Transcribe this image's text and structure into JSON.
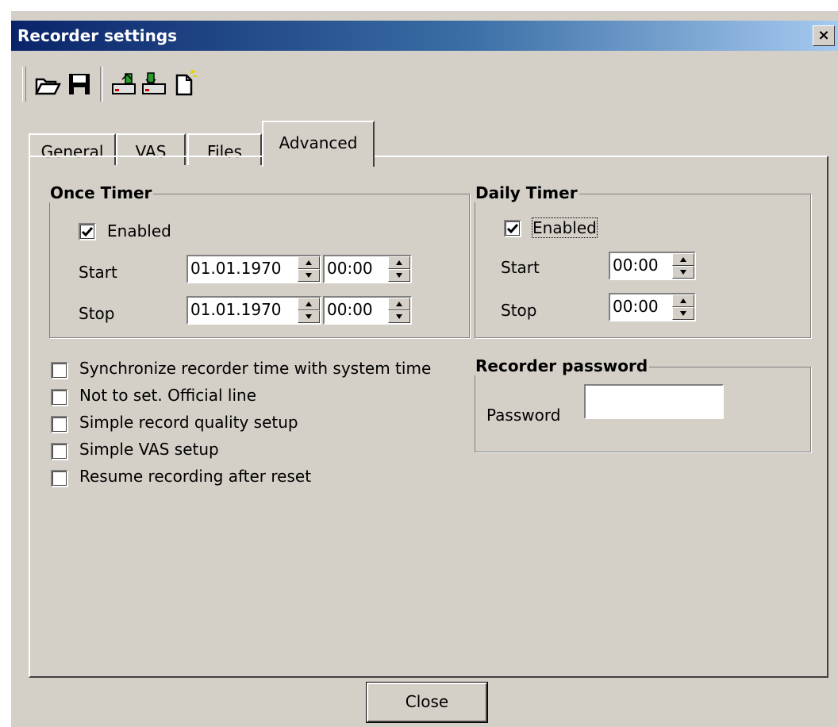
{
  "window": {
    "title": "Recorder settings",
    "close_glyph": "×"
  },
  "toolbar": {
    "buttons": [
      {
        "icon": "open-folder-icon"
      },
      {
        "icon": "save-disk-icon"
      },
      {
        "icon": "read-from-recorder-icon"
      },
      {
        "icon": "write-to-recorder-icon"
      },
      {
        "icon": "new-document-icon"
      }
    ]
  },
  "tabs": [
    {
      "label": "General",
      "active": false
    },
    {
      "label": "VAS",
      "active": false
    },
    {
      "label": "Files",
      "active": false
    },
    {
      "label": "Advanced",
      "active": true
    }
  ],
  "once_timer": {
    "title": "Once Timer",
    "enabled_label": "Enabled",
    "enabled": true,
    "start_label": "Start",
    "stop_label": "Stop",
    "start_date": "01.01.1970",
    "start_time": "00:00",
    "stop_date": "01.01.1970",
    "stop_time": "00:00"
  },
  "daily_timer": {
    "title": "Daily Timer",
    "enabled_label": "Enabled",
    "enabled": true,
    "start_label": "Start",
    "stop_label": "Stop",
    "start_time": "00:00",
    "stop_time": "00:00"
  },
  "options": [
    {
      "label": "Synchronize recorder time with system time",
      "checked": false
    },
    {
      "label": "Not to set. Official line",
      "checked": false
    },
    {
      "label": "Simple record quality setup",
      "checked": false
    },
    {
      "label": "Simple VAS setup",
      "checked": false
    },
    {
      "label": "Resume recording after reset",
      "checked": false
    }
  ],
  "password": {
    "title": "Recorder password",
    "label": "Password",
    "value": ""
  },
  "close_button": {
    "label": "Close"
  },
  "colors": {
    "face": "#d4d0c8",
    "title_start": "#0a246a",
    "title_end": "#a6caf0"
  }
}
